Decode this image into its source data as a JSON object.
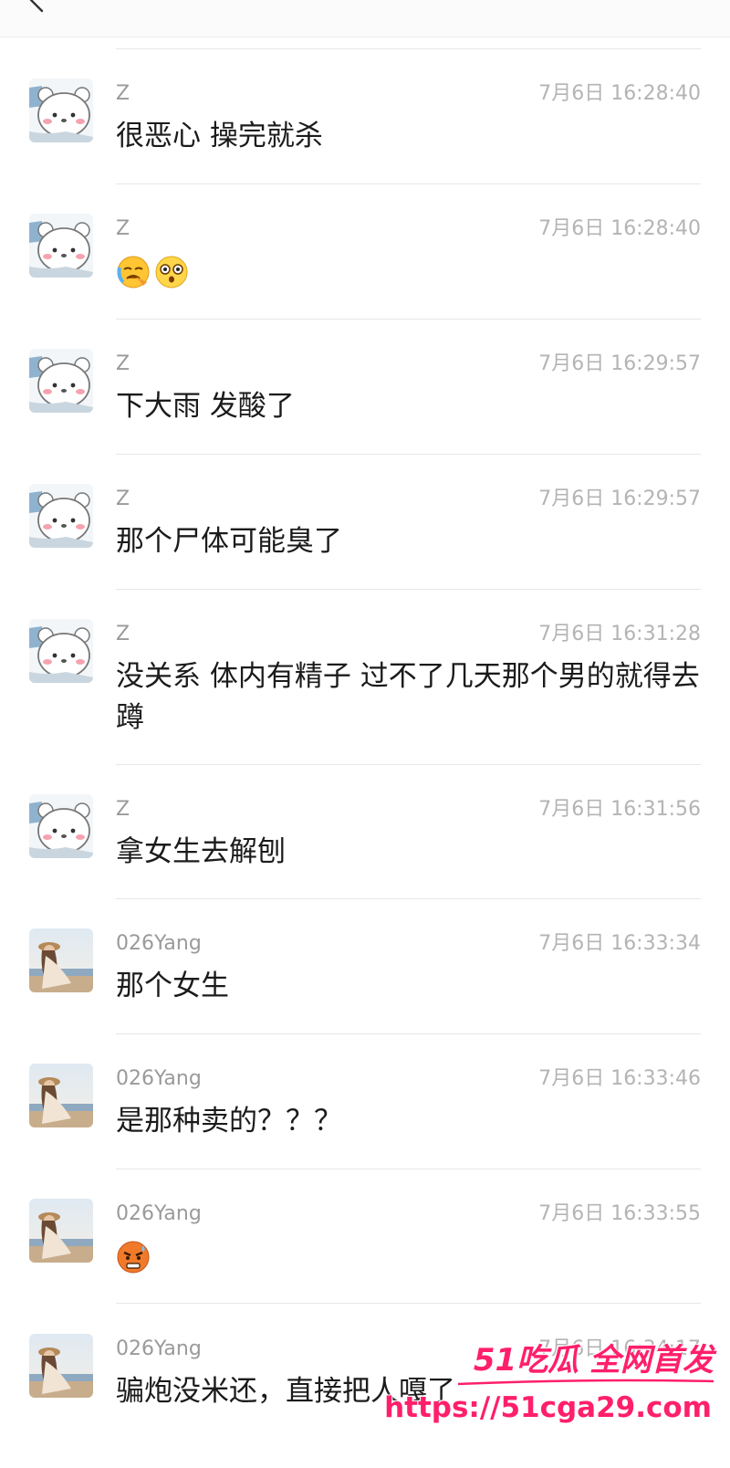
{
  "colors": {
    "accent": "#ff1f6b",
    "timestamp": "#b4b4b4",
    "username": "#9a9a9a",
    "divider": "#e6e6e6"
  },
  "messages": [
    {
      "name": "Z",
      "time": "7月6日 16:28:40",
      "text": "很恶心 操完就杀",
      "avatar": "bear-avatar"
    },
    {
      "name": "Z",
      "time": "7月6日 16:28:40",
      "text": "",
      "emojis": [
        "crying-emoji",
        "shocked-emoji"
      ],
      "avatar": "bear-avatar"
    },
    {
      "name": "Z",
      "time": "7月6日 16:29:57",
      "text": "下大雨 发酸了",
      "avatar": "bear-avatar"
    },
    {
      "name": "Z",
      "time": "7月6日 16:29:57",
      "text": "那个尸体可能臭了",
      "avatar": "bear-avatar"
    },
    {
      "name": "Z",
      "time": "7月6日 16:31:28",
      "text": "没关系 体内有精子 过不了几天那个男的就得去蹲",
      "avatar": "bear-avatar"
    },
    {
      "name": "Z",
      "time": "7月6日 16:31:56",
      "text": "拿女生去解刨",
      "avatar": "bear-avatar"
    },
    {
      "name": "026Yang",
      "time": "7月6日 16:33:34",
      "text": "那个女生",
      "avatar": "photo-avatar"
    },
    {
      "name": "026Yang",
      "time": "7月6日 16:33:46",
      "text": "是那种卖的？？？",
      "avatar": "photo-avatar"
    },
    {
      "name": "026Yang",
      "time": "7月6日 16:33:55",
      "text": "",
      "emojis": [
        "angry-sweat-emoji"
      ],
      "avatar": "photo-avatar"
    },
    {
      "name": "026Yang",
      "time": "7月6日 16:34:17",
      "text": "骗炮没米还，直接把人嘎了",
      "avatar": "photo-avatar"
    }
  ],
  "watermark": {
    "brand": "51吃瓜 全网首发",
    "url": "https://51cga29.com"
  }
}
